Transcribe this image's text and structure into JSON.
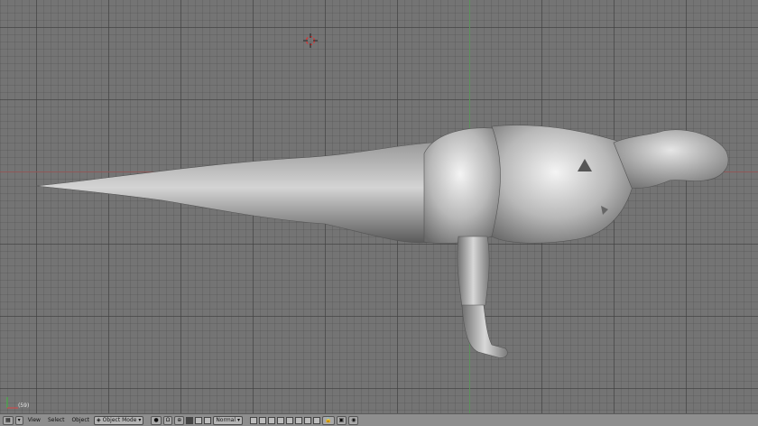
{
  "viewport": {
    "frame_label": "(59)"
  },
  "header": {
    "menus": [
      "View",
      "Select",
      "Object"
    ],
    "mode": "Object Mode",
    "pivot": "Normal"
  },
  "colors": {
    "viewport_bg": "#747474",
    "header_bg": "#8e8e8e",
    "x_axis": "#a05a5a",
    "z_axis": "#5e9d5e"
  },
  "icons": [
    "3d-cursor-icon",
    "axes-icon",
    "editor-type-icon",
    "draw-type-icon",
    "lock-icon"
  ]
}
